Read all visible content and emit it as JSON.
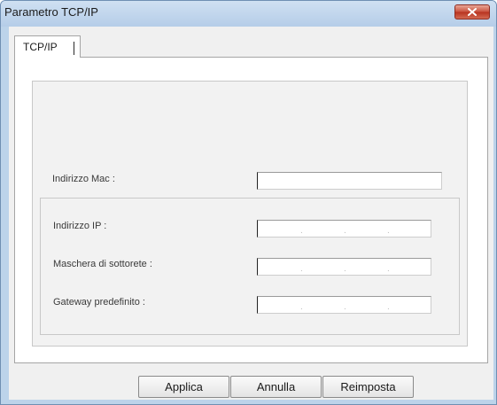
{
  "window": {
    "title": "Parametro TCP/IP"
  },
  "icons": {
    "close": "close-x-icon"
  },
  "tabs": [
    {
      "label": "TCP/IP",
      "selected": true
    }
  ],
  "form": {
    "mac_label": "Indirizzo Mac :",
    "mac_value": "",
    "ip_label": "Indirizzo IP :",
    "subnet_label": "Maschera di sottorete :",
    "gateway_label": "Gateway predefinito :",
    "ip_separator": "."
  },
  "buttons": {
    "apply": "Applica",
    "cancel": "Annulla",
    "reset": "Reimposta"
  },
  "colors": {
    "titlebar": "#bcd3ea",
    "close_button": "#c9503c"
  }
}
